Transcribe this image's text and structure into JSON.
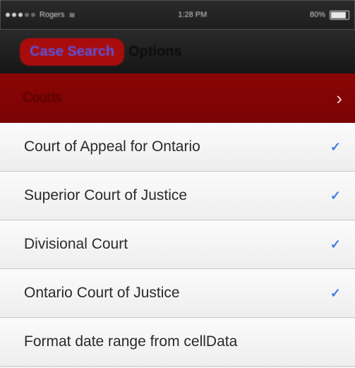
{
  "status_bar": {
    "carrier": "Rogers",
    "time": "1:28 PM",
    "battery_percent": "80%"
  },
  "nav": {
    "back_label": "Case Search",
    "title": "Options"
  },
  "banner": {
    "label": "Courts",
    "chevron_icon": "chevron-right-icon"
  },
  "list": {
    "items": [
      {
        "label": "Court of Appeal for Ontario",
        "checked": true
      },
      {
        "label": "Superior Court of Justice",
        "checked": true
      },
      {
        "label": "Divisional Court",
        "checked": true
      },
      {
        "label": "Ontario Court of Justice",
        "checked": true
      },
      {
        "label": "Format date range from cellData",
        "checked": false
      }
    ]
  },
  "colors": {
    "accent": "#a80c0c",
    "banner": "#8b0606",
    "check": "#3d7fe0"
  }
}
